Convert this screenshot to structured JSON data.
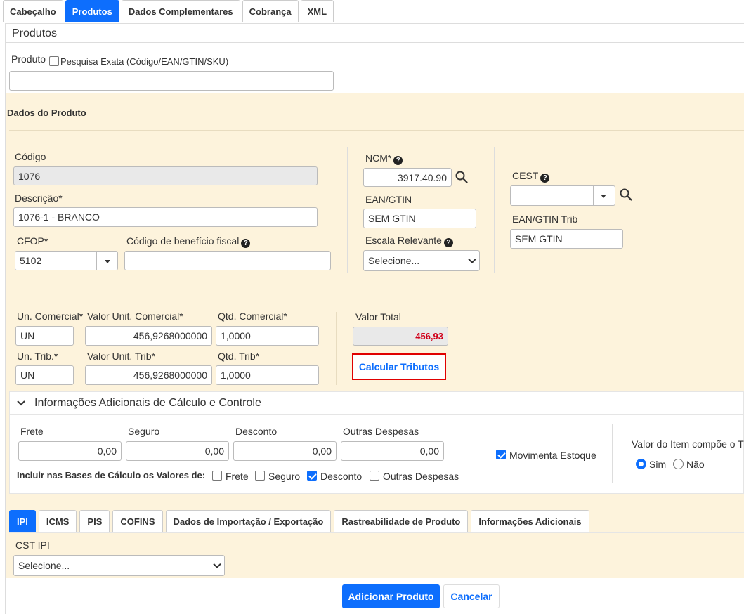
{
  "top_tabs": [
    {
      "label": "Cabeçalho",
      "active": false
    },
    {
      "label": "Produtos",
      "active": true
    },
    {
      "label": "Dados Complementares",
      "active": false
    },
    {
      "label": "Cobrança",
      "active": false
    },
    {
      "label": "XML",
      "active": false
    }
  ],
  "panel_title": "Produtos",
  "search": {
    "label": "Produto",
    "exact_label": "Pesquisa Exata (Código/EAN/GTIN/SKU)",
    "value": ""
  },
  "section_title": "Dados do Produto",
  "product": {
    "codigo_label": "Código",
    "codigo_value": "1076",
    "descricao_label": "Descrição*",
    "descricao_value": "1076-1 - BRANCO",
    "cfop_label": "CFOP*",
    "cfop_value": "5102",
    "beneficio_label": "Código de benefício fiscal",
    "beneficio_value": "",
    "ncm_label": "NCM*",
    "ncm_value": "3917.40.90",
    "ean_label": "EAN/GTIN",
    "ean_value": "SEM GTIN",
    "escala_label": "Escala Relevante",
    "escala_value": "Selecione...",
    "cest_label": "CEST",
    "cest_value": "",
    "ean_trib_label": "EAN/GTIN Trib",
    "ean_trib_value": "SEM GTIN"
  },
  "values": {
    "un_com_label": "Un. Comercial*",
    "un_com_value": "UN",
    "vl_unit_com_label": "Valor Unit. Comercial*",
    "vl_unit_com_value": "456,9268000000",
    "qtd_com_label": "Qtd. Comercial*",
    "qtd_com_value": "1,0000",
    "un_trib_label": "Un. Trib.*",
    "un_trib_value": "UN",
    "vl_unit_trib_label": "Valor Unit. Trib*",
    "vl_unit_trib_value": "456,9268000000",
    "qtd_trib_label": "Qtd. Trib*",
    "qtd_trib_value": "1,0000",
    "total_label": "Valor Total",
    "total_value": "456,93",
    "calc_button": "Calcular Tributos"
  },
  "additional": {
    "title": "Informações Adicionais de Cálculo e Controle",
    "frete_label": "Frete",
    "frete_value": "0,00",
    "seguro_label": "Seguro",
    "seguro_value": "0,00",
    "desconto_label": "Desconto",
    "desconto_value": "0,00",
    "outras_label": "Outras Despesas",
    "outras_value": "0,00",
    "bases_label": "Incluir nas Bases de Cálculo os Valores de:",
    "base_frete": "Frete",
    "base_seguro": "Seguro",
    "base_desconto": "Desconto",
    "base_outras": "Outras Despesas",
    "movimenta_label": "Movimenta Estoque",
    "valor_item_label": "Valor do Item compõe o T",
    "sim_label": "Sim",
    "nao_label": "Não"
  },
  "sub_tabs": [
    {
      "label": "IPI",
      "active": true
    },
    {
      "label": "ICMS",
      "active": false
    },
    {
      "label": "PIS",
      "active": false
    },
    {
      "label": "COFINS",
      "active": false
    },
    {
      "label": "Dados de Importação / Exportação",
      "active": false
    },
    {
      "label": "Rastreabilidade de Produto",
      "active": false
    },
    {
      "label": "Informações Adicionais",
      "active": false
    }
  ],
  "ipi": {
    "cst_label": "CST IPI",
    "cst_value": "Selecione..."
  },
  "footer": {
    "add_button": "Adicionar Produto",
    "cancel_button": "Cancelar"
  },
  "colors": {
    "accent": "#0d6efd",
    "panel_bg": "#fdf3dc",
    "total_red": "#d0021b",
    "highlight_border": "#e00000"
  }
}
